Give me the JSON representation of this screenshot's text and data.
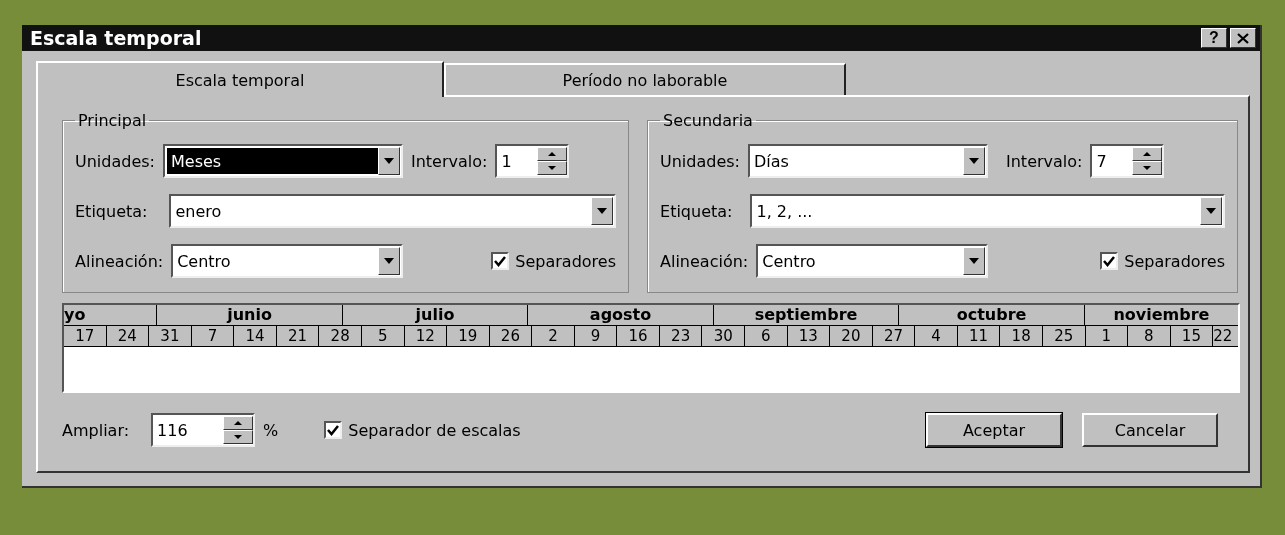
{
  "window": {
    "title": "Escala temporal",
    "help": "?"
  },
  "tabs": [
    {
      "label": "Escala temporal",
      "selected": true
    },
    {
      "label": "Período no laborable",
      "selected": false
    }
  ],
  "groups": [
    {
      "title": "Principal",
      "units_label": "Unidades:",
      "units": "Meses",
      "units_focused": true,
      "interval_label": "Intervalo:",
      "interval": "1",
      "label_label": "Etiqueta:",
      "label": "enero",
      "alignment_label": "Alineación:",
      "alignment": "Centro",
      "separators": {
        "label": "Separadores",
        "checked": true
      }
    },
    {
      "title": "Secundaria",
      "units_label": "Unidades:",
      "units": "Días",
      "units_focused": false,
      "interval_label": "Intervalo:",
      "interval": "7",
      "label_label": "Etiqueta:",
      "label": "1, 2, ...",
      "alignment_label": "Alineación:",
      "alignment": "Centro",
      "separators": {
        "label": "Separadores",
        "checked": true
      }
    }
  ],
  "timescale": {
    "months": [
      "yo",
      "junio",
      "julio",
      "agosto",
      "septiembre",
      "octubre",
      "noviembre"
    ],
    "days": [
      "17",
      "24",
      "31",
      "7",
      "14",
      "21",
      "28",
      "5",
      "12",
      "19",
      "26",
      "2",
      "9",
      "16",
      "23",
      "30",
      "6",
      "13",
      "20",
      "27",
      "4",
      "11",
      "18",
      "25",
      "1",
      "8",
      "15",
      "22"
    ]
  },
  "zoom": {
    "label": "Ampliar:",
    "value": "116",
    "unit": "%"
  },
  "scale_separator": {
    "label": "Separador de escalas",
    "checked": true
  },
  "buttons": [
    {
      "label": "Aceptar",
      "default": true
    },
    {
      "label": "Cancelar",
      "default": false
    }
  ]
}
